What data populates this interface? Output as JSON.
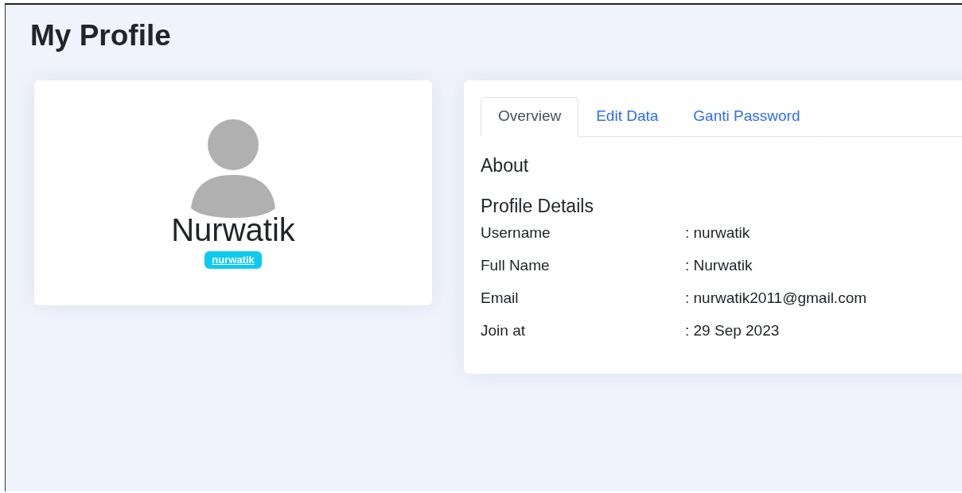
{
  "page_title": "My Profile",
  "profile_card": {
    "name": "Nurwatik",
    "username_badge": "nurwatik"
  },
  "tabs": [
    {
      "label": "Overview",
      "selected": true
    },
    {
      "label": "Edit Data",
      "selected": false
    },
    {
      "label": "Ganti Password",
      "selected": false
    }
  ],
  "about_heading": "About",
  "details_heading": "Profile Details",
  "details": [
    {
      "label": "Username",
      "value": ": nurwatik"
    },
    {
      "label": "Full Name",
      "value": ": Nurwatik"
    },
    {
      "label": "Email",
      "value": ": nurwatik2011@gmail.com"
    },
    {
      "label": "Join at",
      "value": ": 29 Sep 2023"
    }
  ]
}
